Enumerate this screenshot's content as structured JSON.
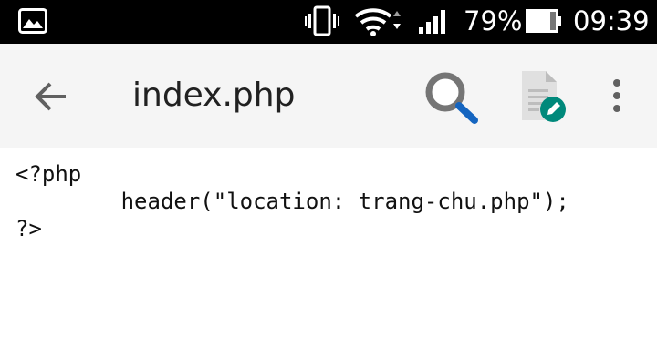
{
  "status_bar": {
    "battery_percent": "79%",
    "clock": "09:39",
    "icons": [
      "gallery-notification-icon",
      "vibrate-icon",
      "wifi-icon",
      "cell-signal-icon",
      "battery-icon"
    ]
  },
  "app_bar": {
    "title": "index.php",
    "back_icon": "arrow-back-icon",
    "search_icon": "search-icon",
    "edit_icon": "edit-document-icon",
    "overflow_icon": "more-vert-icon"
  },
  "editor": {
    "lines": [
      "<?php",
      "        header(\"location: trang-chu.php\");",
      "?>"
    ]
  },
  "colors": {
    "status_bar": "#000000",
    "app_bar": "#f5f5f5",
    "search_handle": "#1565c0",
    "edit_badge": "#00897b",
    "text": "#212121"
  }
}
